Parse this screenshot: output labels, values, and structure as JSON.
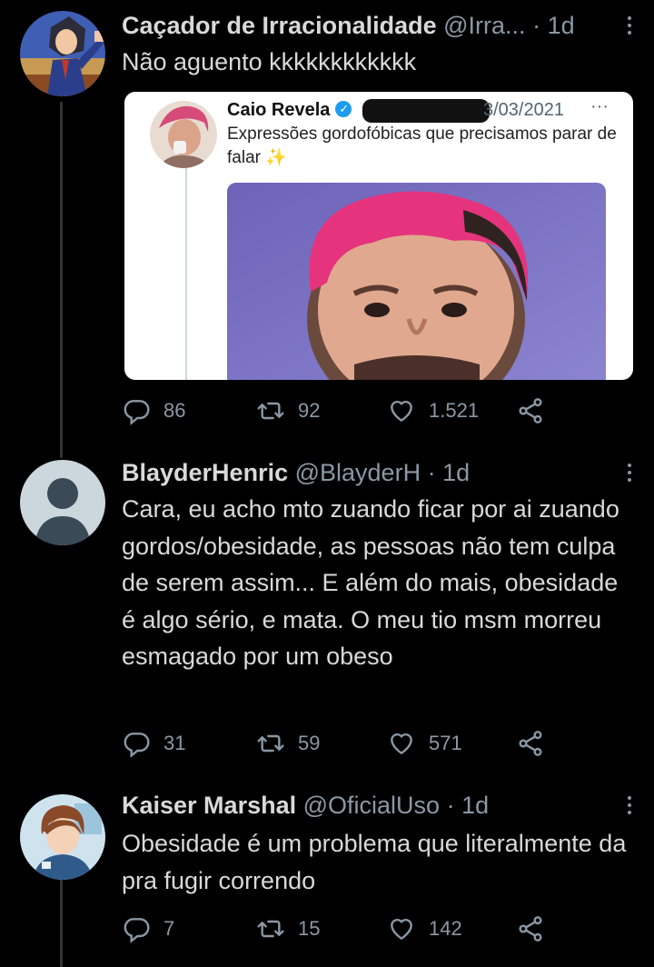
{
  "tweets": [
    {
      "name": "Caçador de Irracionalidade",
      "handle": "@Irra...",
      "dot": "·",
      "time": "1d",
      "text": "Não aguento kkkkkkkkkkkk",
      "reply_count": "86",
      "retweet_count": "92",
      "like_count": "1.521",
      "embed": {
        "name": "Caio Revela",
        "date": "3/03/2021",
        "more": "···",
        "text": "Expressões gordofóbicas que precisamos parar de falar",
        "sparkle": "✨"
      }
    },
    {
      "name": "BlayderHenric",
      "handle": "@BlayderH",
      "dot": "·",
      "time": "1d",
      "text": "Cara, eu acho mto zuando ficar por ai zuando gordos/obesidade, as pessoas não tem culpa de serem assim... E além do mais, obesidade é algo sério, e mata. O meu tio msm morreu esmagado por um obeso",
      "reply_count": "31",
      "retweet_count": "59",
      "like_count": "571"
    },
    {
      "name": "Kaiser Marshal",
      "handle": "@OficialUso",
      "dot": "·",
      "time": "1d",
      "text": "Obesidade é um problema que literalmente da pra fugir correndo",
      "reply_count": "7",
      "retweet_count": "15",
      "like_count": "142"
    }
  ],
  "icons": {
    "reply": "reply-icon",
    "retweet": "retweet-icon",
    "like": "heart-icon",
    "share": "share-icon",
    "more": "more-vertical-icon"
  },
  "colors": {
    "background": "#000000",
    "text": "#d9d9d9",
    "secondary": "#8b98a5",
    "thread_line": "#333639"
  }
}
